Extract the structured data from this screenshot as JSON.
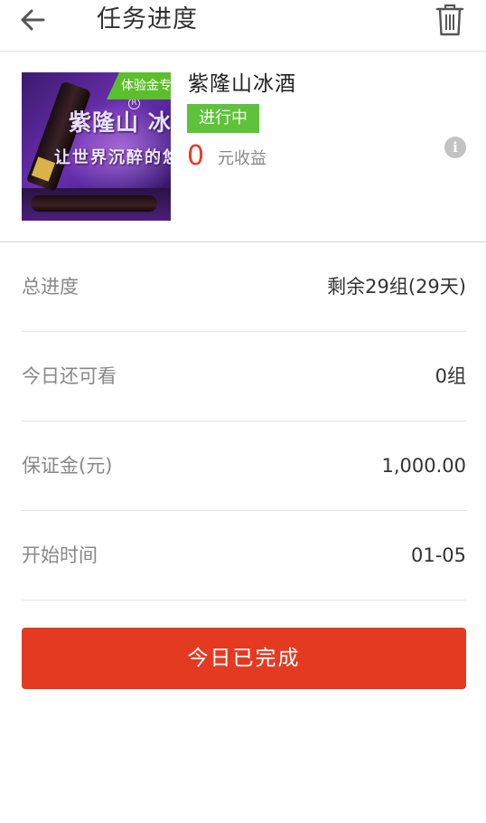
{
  "header": {
    "title": "任务进度",
    "back_icon": "arrow-left-icon",
    "delete_icon": "trash-icon"
  },
  "task": {
    "thumbnail": {
      "ribbon_text": "体验金专",
      "brand_text": "紫隆山 冰",
      "registered_mark": "R",
      "slogan_text": "让世界沉醉的悠"
    },
    "product_name": "紫隆山冰酒",
    "status_label": "进行中",
    "earnings_value": "0",
    "earnings_label": "元收益",
    "info_icon": "info-icon"
  },
  "details": [
    {
      "label": "总进度",
      "value": "剩余29组(29天)"
    },
    {
      "label": "今日还可看",
      "value": "0组"
    },
    {
      "label": "保证金(元)",
      "value": "1,000.00"
    },
    {
      "label": "开始时间",
      "value": "01-05"
    }
  ],
  "action": {
    "complete_label": "今日已完成"
  },
  "colors": {
    "accent_red": "#e53a22",
    "status_green": "#5ec33a",
    "earnings_red": "#e53b2a"
  }
}
